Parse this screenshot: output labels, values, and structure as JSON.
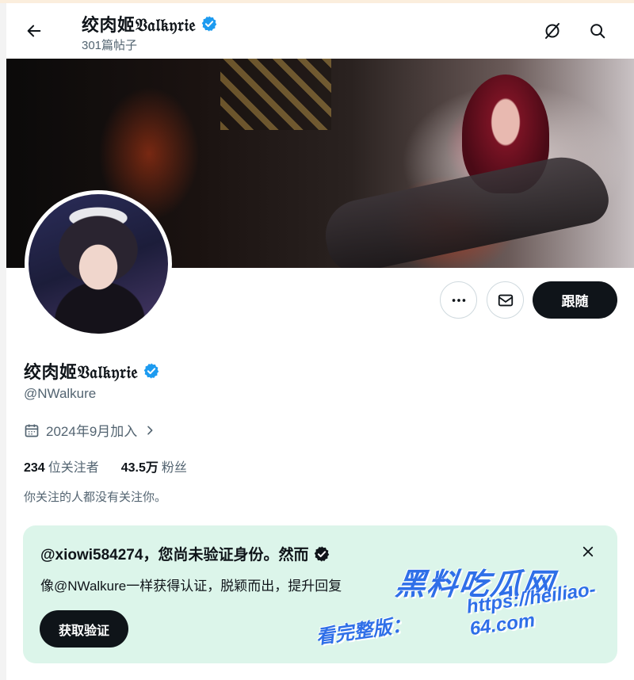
{
  "header": {
    "display_name": "绞肉姬𝔙𝔞𝔩𝔨𝔶𝔯𝔦𝔢",
    "post_count": "301篇帖子"
  },
  "icons": {
    "back": "arrow-left-icon",
    "grok": "grok-icon",
    "search": "search-icon",
    "more": "more-icon",
    "message": "envelope-icon",
    "calendar": "calendar-icon",
    "chevron": "chevron-right-icon",
    "verified": "verified-badge-icon",
    "close": "close-icon"
  },
  "actions": {
    "follow_label": "跟随"
  },
  "profile": {
    "display_name": "绞肉姬𝔙𝔞𝔩𝔨𝔶𝔯𝔦𝔢",
    "handle": "@NWalkure",
    "joined": "2024年9月加入",
    "following_count": "234",
    "following_label": "位关注者",
    "followers_count": "43.5万",
    "followers_label": "粉丝",
    "not_followed_notice": "你关注的人都没有关注你。"
  },
  "verify_card": {
    "title": "@xiowi584274，您尚未验证身份。然而",
    "body": "像@NWalkure一样获得认证，脱颖而出，提升回复",
    "button_label": "获取验证"
  },
  "watermark": {
    "site_name": "黑料吃瓜网",
    "domain": "https://heiliao-64.com",
    "prefix": "看完整版："
  },
  "colors": {
    "verified_blue": "#1d9bf0",
    "card_bg": "#dcf5ea",
    "text_primary": "#0f1419",
    "text_secondary": "#536471",
    "watermark": "#2f6fe8"
  }
}
